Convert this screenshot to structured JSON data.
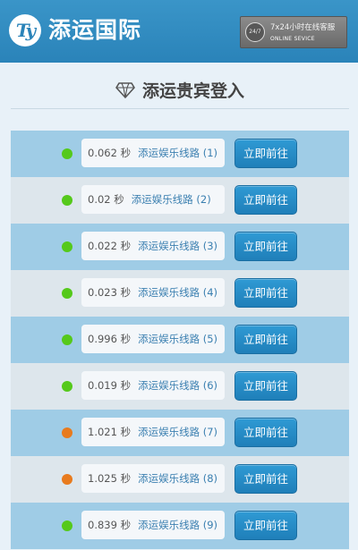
{
  "header": {
    "logo_glyph": "Ty",
    "brand": "添运国际",
    "service": {
      "badge": "24/7",
      "line1": "7x24小时在线客服",
      "line2": "ONLINE SEVICE"
    }
  },
  "title": "添运贵宾登入",
  "colors": {
    "header": "#2a83b9",
    "row_blue": "#9fcce6",
    "row_light": "#dde6ec",
    "status_good": "#55c91b",
    "status_slow": "#e87b1e",
    "button": "#1f7fb9"
  },
  "routes": [
    {
      "speed": "0.062 秒",
      "name": "添运娱乐线路 (1)",
      "status": "good",
      "button": "立即前往"
    },
    {
      "speed": "0.02 秒",
      "name": "添运娱乐线路 (2)",
      "status": "good",
      "button": "立即前往"
    },
    {
      "speed": "0.022 秒",
      "name": "添运娱乐线路 (3)",
      "status": "good",
      "button": "立即前往"
    },
    {
      "speed": "0.023 秒",
      "name": "添运娱乐线路 (4)",
      "status": "good",
      "button": "立即前往"
    },
    {
      "speed": "0.996 秒",
      "name": "添运娱乐线路 (5)",
      "status": "good",
      "button": "立即前往"
    },
    {
      "speed": "0.019 秒",
      "name": "添运娱乐线路 (6)",
      "status": "good",
      "button": "立即前往"
    },
    {
      "speed": "1.021 秒",
      "name": "添运娱乐线路 (7)",
      "status": "slow",
      "button": "立即前往"
    },
    {
      "speed": "1.025 秒",
      "name": "添运娱乐线路 (8)",
      "status": "slow",
      "button": "立即前往"
    },
    {
      "speed": "0.839 秒",
      "name": "添运娱乐线路 (9)",
      "status": "good",
      "button": "立即前往"
    }
  ]
}
